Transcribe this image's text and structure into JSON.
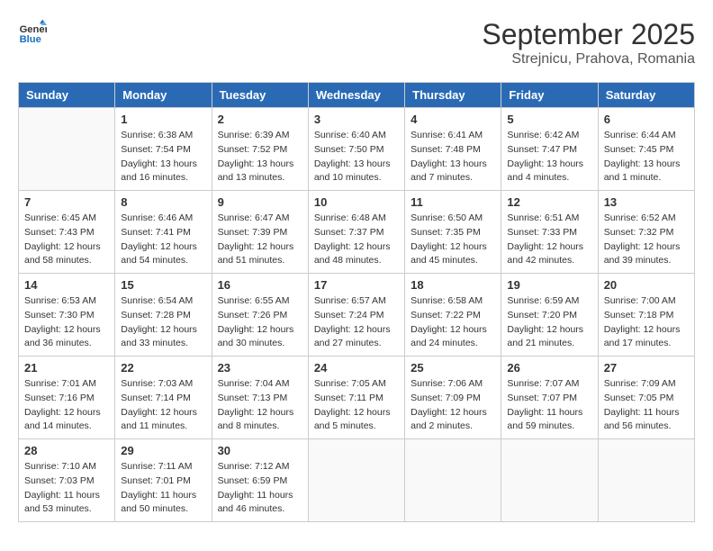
{
  "logo": {
    "line1": "General",
    "line2": "Blue"
  },
  "title": "September 2025",
  "subtitle": "Strejnicu, Prahova, Romania",
  "days_of_week": [
    "Sunday",
    "Monday",
    "Tuesday",
    "Wednesday",
    "Thursday",
    "Friday",
    "Saturday"
  ],
  "weeks": [
    [
      {
        "day": "",
        "info": ""
      },
      {
        "day": "1",
        "info": "Sunrise: 6:38 AM\nSunset: 7:54 PM\nDaylight: 13 hours\nand 16 minutes."
      },
      {
        "day": "2",
        "info": "Sunrise: 6:39 AM\nSunset: 7:52 PM\nDaylight: 13 hours\nand 13 minutes."
      },
      {
        "day": "3",
        "info": "Sunrise: 6:40 AM\nSunset: 7:50 PM\nDaylight: 13 hours\nand 10 minutes."
      },
      {
        "day": "4",
        "info": "Sunrise: 6:41 AM\nSunset: 7:48 PM\nDaylight: 13 hours\nand 7 minutes."
      },
      {
        "day": "5",
        "info": "Sunrise: 6:42 AM\nSunset: 7:47 PM\nDaylight: 13 hours\nand 4 minutes."
      },
      {
        "day": "6",
        "info": "Sunrise: 6:44 AM\nSunset: 7:45 PM\nDaylight: 13 hours\nand 1 minute."
      }
    ],
    [
      {
        "day": "7",
        "info": "Sunrise: 6:45 AM\nSunset: 7:43 PM\nDaylight: 12 hours\nand 58 minutes."
      },
      {
        "day": "8",
        "info": "Sunrise: 6:46 AM\nSunset: 7:41 PM\nDaylight: 12 hours\nand 54 minutes."
      },
      {
        "day": "9",
        "info": "Sunrise: 6:47 AM\nSunset: 7:39 PM\nDaylight: 12 hours\nand 51 minutes."
      },
      {
        "day": "10",
        "info": "Sunrise: 6:48 AM\nSunset: 7:37 PM\nDaylight: 12 hours\nand 48 minutes."
      },
      {
        "day": "11",
        "info": "Sunrise: 6:50 AM\nSunset: 7:35 PM\nDaylight: 12 hours\nand 45 minutes."
      },
      {
        "day": "12",
        "info": "Sunrise: 6:51 AM\nSunset: 7:33 PM\nDaylight: 12 hours\nand 42 minutes."
      },
      {
        "day": "13",
        "info": "Sunrise: 6:52 AM\nSunset: 7:32 PM\nDaylight: 12 hours\nand 39 minutes."
      }
    ],
    [
      {
        "day": "14",
        "info": "Sunrise: 6:53 AM\nSunset: 7:30 PM\nDaylight: 12 hours\nand 36 minutes."
      },
      {
        "day": "15",
        "info": "Sunrise: 6:54 AM\nSunset: 7:28 PM\nDaylight: 12 hours\nand 33 minutes."
      },
      {
        "day": "16",
        "info": "Sunrise: 6:55 AM\nSunset: 7:26 PM\nDaylight: 12 hours\nand 30 minutes."
      },
      {
        "day": "17",
        "info": "Sunrise: 6:57 AM\nSunset: 7:24 PM\nDaylight: 12 hours\nand 27 minutes."
      },
      {
        "day": "18",
        "info": "Sunrise: 6:58 AM\nSunset: 7:22 PM\nDaylight: 12 hours\nand 24 minutes."
      },
      {
        "day": "19",
        "info": "Sunrise: 6:59 AM\nSunset: 7:20 PM\nDaylight: 12 hours\nand 21 minutes."
      },
      {
        "day": "20",
        "info": "Sunrise: 7:00 AM\nSunset: 7:18 PM\nDaylight: 12 hours\nand 17 minutes."
      }
    ],
    [
      {
        "day": "21",
        "info": "Sunrise: 7:01 AM\nSunset: 7:16 PM\nDaylight: 12 hours\nand 14 minutes."
      },
      {
        "day": "22",
        "info": "Sunrise: 7:03 AM\nSunset: 7:14 PM\nDaylight: 12 hours\nand 11 minutes."
      },
      {
        "day": "23",
        "info": "Sunrise: 7:04 AM\nSunset: 7:13 PM\nDaylight: 12 hours\nand 8 minutes."
      },
      {
        "day": "24",
        "info": "Sunrise: 7:05 AM\nSunset: 7:11 PM\nDaylight: 12 hours\nand 5 minutes."
      },
      {
        "day": "25",
        "info": "Sunrise: 7:06 AM\nSunset: 7:09 PM\nDaylight: 12 hours\nand 2 minutes."
      },
      {
        "day": "26",
        "info": "Sunrise: 7:07 AM\nSunset: 7:07 PM\nDaylight: 11 hours\nand 59 minutes."
      },
      {
        "day": "27",
        "info": "Sunrise: 7:09 AM\nSunset: 7:05 PM\nDaylight: 11 hours\nand 56 minutes."
      }
    ],
    [
      {
        "day": "28",
        "info": "Sunrise: 7:10 AM\nSunset: 7:03 PM\nDaylight: 11 hours\nand 53 minutes."
      },
      {
        "day": "29",
        "info": "Sunrise: 7:11 AM\nSunset: 7:01 PM\nDaylight: 11 hours\nand 50 minutes."
      },
      {
        "day": "30",
        "info": "Sunrise: 7:12 AM\nSunset: 6:59 PM\nDaylight: 11 hours\nand 46 minutes."
      },
      {
        "day": "",
        "info": ""
      },
      {
        "day": "",
        "info": ""
      },
      {
        "day": "",
        "info": ""
      },
      {
        "day": "",
        "info": ""
      }
    ]
  ]
}
